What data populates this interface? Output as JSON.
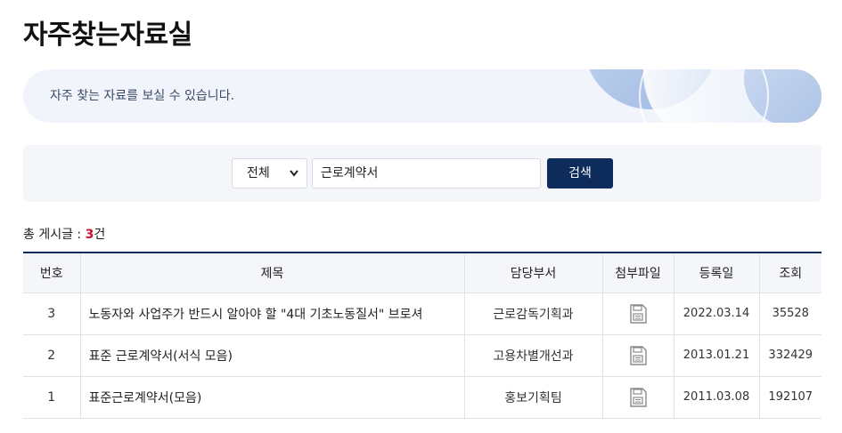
{
  "page": {
    "title": "자주찾는자료실",
    "banner_text": "자주 찾는 자료를 보실 수 있습니다."
  },
  "search": {
    "category_selected": "전체",
    "query": "근로계약서",
    "button_label": "검색"
  },
  "summary": {
    "prefix": "총 게시글 : ",
    "count": "3",
    "suffix": "건"
  },
  "table": {
    "headers": {
      "no": "번호",
      "title": "제목",
      "department": "담당부서",
      "attachment": "첨부파일",
      "date": "등록일",
      "views": "조회"
    },
    "rows": [
      {
        "no": "3",
        "title": "노동자와 사업주가 반드시 알아야 할 \"4대 기초노동질서\" 브로셔",
        "department": "근로감독기획과",
        "attachment_icon": "file-icon",
        "date": "2022.03.14",
        "views": "35528"
      },
      {
        "no": "2",
        "title": "표준 근로계약서(서식 모음)",
        "department": "고용차별개선과",
        "attachment_icon": "file-icon",
        "date": "2013.01.21",
        "views": "332429"
      },
      {
        "no": "1",
        "title": "표준근로계약서(모음)",
        "department": "홍보기획팀",
        "attachment_icon": "file-icon",
        "date": "2011.03.08",
        "views": "192107"
      }
    ]
  },
  "colors": {
    "accent_navy": "#0d2c5c",
    "count_red": "#c8102e",
    "banner_bg": "#f1f5fb",
    "panel_bg": "#f4f6f9"
  }
}
